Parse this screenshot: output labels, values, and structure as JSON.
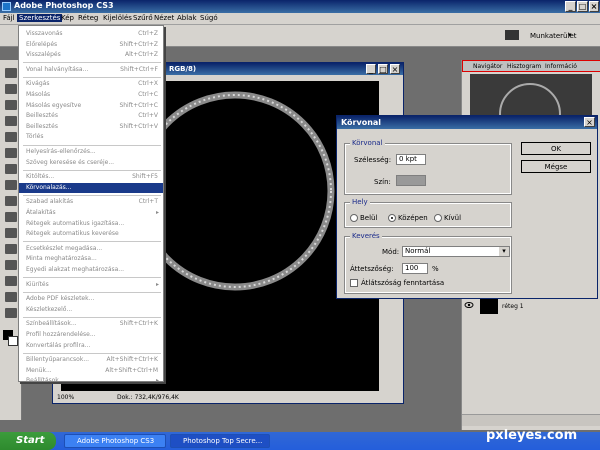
{
  "app": {
    "title": "Adobe Photoshop CS3"
  },
  "menubar": {
    "items": [
      "Fájl",
      "Szerkesztés",
      "Kép",
      "Réteg",
      "Kijelölés",
      "Szűrő",
      "Nézet",
      "Ablak",
      "Súgó"
    ]
  },
  "optbar": {
    "workspace": "Munkaterület"
  },
  "edit_menu": {
    "items": [
      {
        "label": "Visszavonás",
        "shortcut": "Ctrl+Z"
      },
      {
        "label": "Előrelépés",
        "shortcut": "Shift+Ctrl+Z"
      },
      {
        "label": "Visszalépés",
        "shortcut": "Alt+Ctrl+Z"
      },
      {
        "label": "Vonal halványítása...",
        "shortcut": "Shift+Ctrl+F"
      },
      {
        "label": "Kivágás",
        "shortcut": "Ctrl+X"
      },
      {
        "label": "Másolás",
        "shortcut": "Ctrl+C"
      },
      {
        "label": "Másolás egyesítve",
        "shortcut": "Shift+Ctrl+C"
      },
      {
        "label": "Beillesztés",
        "shortcut": "Ctrl+V"
      },
      {
        "label": "Beillesztés",
        "shortcut": "Shift+Ctrl+V"
      },
      {
        "label": "Törlés",
        "shortcut": ""
      },
      {
        "label": "Helyesírás-ellenőrzés...",
        "shortcut": ""
      },
      {
        "label": "Szöveg keresése és cseréje...",
        "shortcut": ""
      },
      {
        "label": "Kitöltés...",
        "shortcut": "Shift+F5"
      },
      {
        "label": "Körvonalazás...",
        "shortcut": ""
      },
      {
        "label": "Szabad alakítás",
        "shortcut": "Ctrl+T"
      },
      {
        "label": "Átalakítás",
        "shortcut": ""
      },
      {
        "label": "Rétegek automatikus igazítása...",
        "shortcut": ""
      },
      {
        "label": "Rétegek automatikus keverése",
        "shortcut": ""
      },
      {
        "label": "Ecsetkészlet megadása...",
        "shortcut": ""
      },
      {
        "label": "Minta meghatározása...",
        "shortcut": ""
      },
      {
        "label": "Egyedi alakzat meghatározása...",
        "shortcut": ""
      },
      {
        "label": "Kiürítés",
        "shortcut": ""
      },
      {
        "label": "Adobe PDF készletek...",
        "shortcut": ""
      },
      {
        "label": "Készletkezelő...",
        "shortcut": ""
      },
      {
        "label": "Színbeállítások...",
        "shortcut": "Shift+Ctrl+K"
      },
      {
        "label": "Profil hozzárendelése...",
        "shortcut": ""
      },
      {
        "label": "Konvertálás profilra...",
        "shortcut": ""
      },
      {
        "label": "Billentyűparancsok...",
        "shortcut": "Alt+Shift+Ctrl+K"
      },
      {
        "label": "Menük...",
        "shortcut": "Alt+Shift+Ctrl+M"
      },
      {
        "label": "Beállítások",
        "shortcut": ""
      }
    ]
  },
  "document": {
    "title": "RGB/8)",
    "zoom": "100%",
    "doc_info": "Dok.: 732,4K/976,4K"
  },
  "navigator": {
    "tab1": "Navigátor",
    "tab2": "Hisztogram",
    "tab3": "Információ",
    "layer_name": "réteg 1"
  },
  "dialog": {
    "title": "Körvonal",
    "stroke_group": "Körvonal",
    "width_label": "Szélesség:",
    "width_value": "0 kpt",
    "color_label": "Szín:",
    "color_swatch": "#999999",
    "location_group": "Hely",
    "loc_inside": "Belül",
    "loc_center": "Középen",
    "loc_outside": "Kívül",
    "blend_group": "Keverés",
    "mode_label": "Mód:",
    "mode_value": "Normál",
    "opacity_label": "Áttetszőség:",
    "opacity_value": "100",
    "opacity_unit": "%",
    "preserve_label": "Átlátszóság fenntartása",
    "ok": "OK",
    "cancel": "Mégse"
  },
  "taskbar": {
    "start": "Start",
    "task1": "Adobe Photoshop CS3",
    "task2": "Photoshop Top Secre..."
  },
  "watermark": "pxleyes.com"
}
